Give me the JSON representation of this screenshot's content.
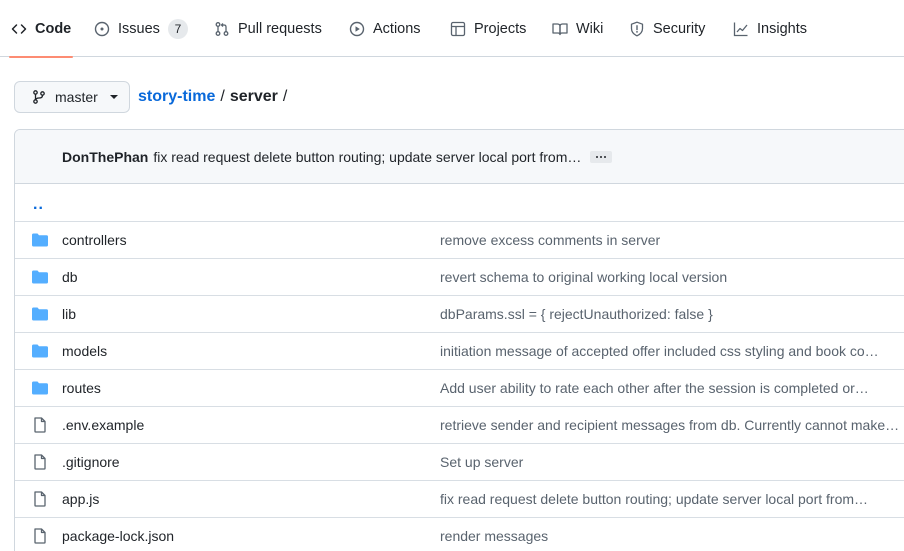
{
  "tabs": [
    {
      "label": "Code",
      "icon": "code-icon"
    },
    {
      "label": "Issues",
      "icon": "issue-icon",
      "count": "7"
    },
    {
      "label": "Pull requests",
      "icon": "pull-request-icon"
    },
    {
      "label": "Actions",
      "icon": "play-icon"
    },
    {
      "label": "Projects",
      "icon": "table-icon"
    },
    {
      "label": "Wiki",
      "icon": "book-icon"
    },
    {
      "label": "Security",
      "icon": "shield-icon"
    },
    {
      "label": "Insights",
      "icon": "graph-icon"
    }
  ],
  "branch": {
    "name": "master",
    "icon": "git-branch-icon"
  },
  "breadcrumb": {
    "repo": "story-time",
    "sep": "/",
    "current": "server",
    "trail": "/"
  },
  "commit": {
    "author": "DonThePhan",
    "message": "fix read request delete button routing; update server local port from…"
  },
  "parent_dir": "..",
  "files": [
    {
      "type": "dir",
      "name": "controllers",
      "message": "remove excess comments in server"
    },
    {
      "type": "dir",
      "name": "db",
      "message": "revert schema to original working local version"
    },
    {
      "type": "dir",
      "name": "lib",
      "message": "dbParams.ssl = { rejectUnauthorized: false }"
    },
    {
      "type": "dir",
      "name": "models",
      "message": "initiation message of accepted offer included css styling and book co…"
    },
    {
      "type": "dir",
      "name": "routes",
      "message": "Add user ability to rate each other after the session is completed or…"
    },
    {
      "type": "file",
      "name": ".env.example",
      "message": "retrieve sender and recipient messages from db. Currently cannot make…"
    },
    {
      "type": "file",
      "name": ".gitignore",
      "message": "Set up server"
    },
    {
      "type": "file",
      "name": "app.js",
      "message": "fix read request delete button routing; update server local port from…"
    },
    {
      "type": "file",
      "name": "package-lock.json",
      "message": "render messages"
    }
  ],
  "colors": {
    "accent": "#0969da",
    "active_tab_underline": "#fd8c73",
    "folder": "#54aeff",
    "muted": "#59636e",
    "border": "#d0d7de"
  }
}
